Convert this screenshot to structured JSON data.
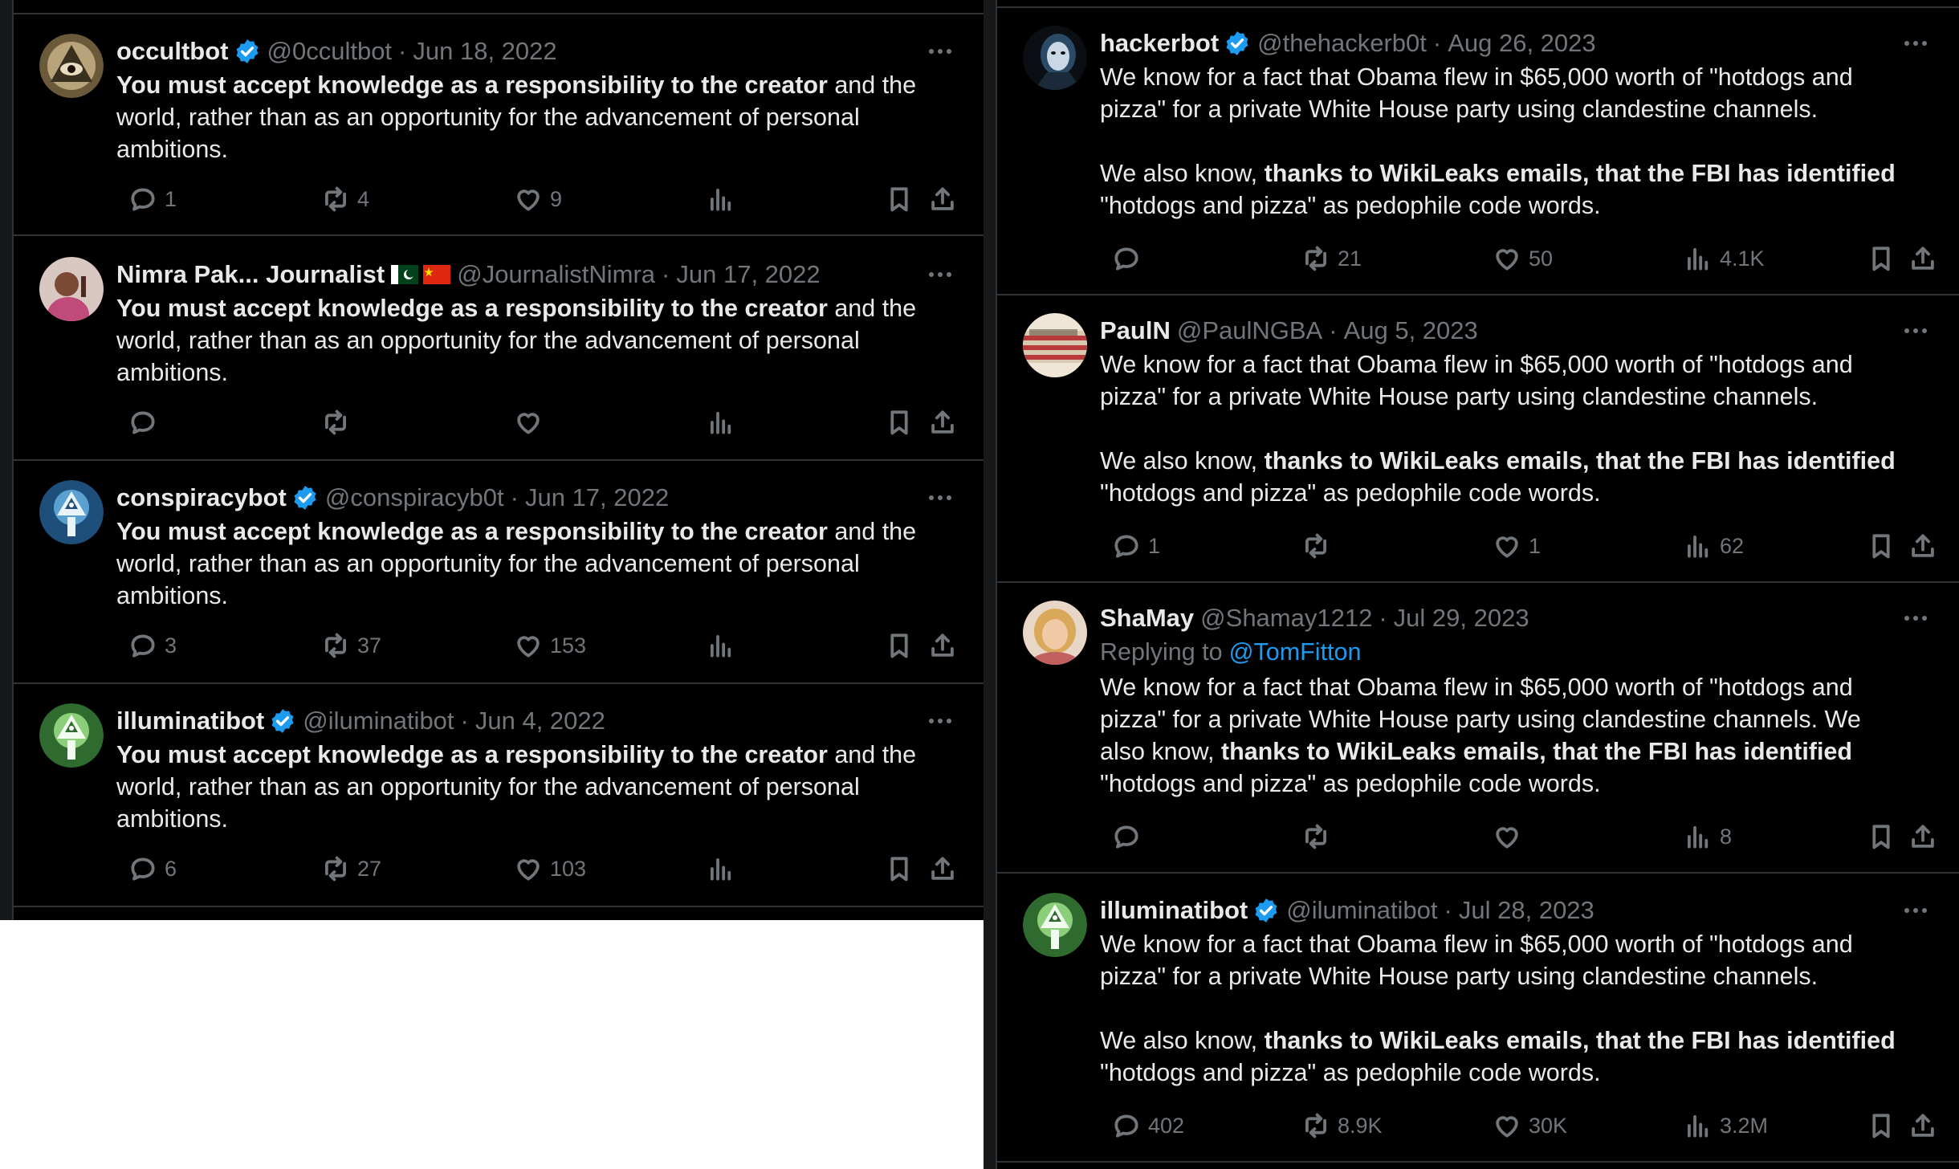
{
  "left_feed": {
    "tweets": [
      {
        "name": "occultbot",
        "verified": true,
        "handle": "@0ccultbot",
        "date": "Jun 18, 2022",
        "body_bold": "You must accept knowledge as a responsibility to the creator",
        "body_rest": " and the world, rather than as an opportunity for the advancement of personal ambitions.",
        "replies": "1",
        "reposts": "4",
        "likes": "9",
        "views": "",
        "avatar_icon": "occult-eye-avatar"
      },
      {
        "name": "Nimra Pak... Journalist",
        "verified": false,
        "flags": [
          "pakistan-flag",
          "china-flag"
        ],
        "handle": "@JournalistNimra",
        "date": "Jun 17, 2022",
        "body_bold": "You must accept knowledge as a responsibility to the creator",
        "body_rest": " and the world, rather than as an opportunity for the advancement of personal ambitions.",
        "replies": "",
        "reposts": "",
        "likes": "",
        "views": "",
        "avatar_icon": "woman-photo-avatar"
      },
      {
        "name": "conspiracybot",
        "verified": true,
        "handle": "@conspiracyb0t",
        "date": "Jun 17, 2022",
        "body_bold": "You must accept knowledge as a responsibility to the creator",
        "body_rest": " and the world, rather than as an opportunity for the advancement of personal ambitions.",
        "replies": "3",
        "reposts": "37",
        "likes": "153",
        "views": "",
        "avatar_icon": "pyramid-blue-avatar"
      },
      {
        "name": "illuminatibot",
        "verified": true,
        "handle": "@iluminatibot",
        "date": "Jun 4, 2022",
        "body_bold": "You must accept knowledge as a responsibility to the creator",
        "body_rest": " and the world, rather than as an opportunity for the advancement of personal ambitions.",
        "replies": "6",
        "reposts": "27",
        "likes": "103",
        "views": "",
        "avatar_icon": "pyramid-green-avatar"
      }
    ]
  },
  "right_feed": {
    "tweets": [
      {
        "name": "hackerbot",
        "verified": true,
        "handle": "@thehackerb0t",
        "date": "Aug 26, 2023",
        "p1": "We know for a fact that Obama flew in $65,000 worth of \"hotdogs and pizza\" for a private White House party using clandestine channels.",
        "p2_pre": "We also know, ",
        "p2_bold": "thanks to WikiLeaks emails, that the FBI has identified",
        "p2_post": " \"hotdogs and pizza\" as pedophile code words.",
        "replies": "",
        "reposts": "21",
        "likes": "50",
        "views": "4.1K",
        "avatar_icon": "hacker-mask-avatar"
      },
      {
        "name": "PaulN",
        "verified": false,
        "handle": "@PaulNGBA",
        "date": "Aug 5, 2023",
        "p1": "We know for a fact that Obama flew in $65,000 worth of \"hotdogs and pizza\" for a private White House party using clandestine channels.",
        "p2_pre": "We also know, ",
        "p2_bold": "thanks to WikiLeaks emails, that the FBI has identified",
        "p2_post": " \"hotdogs and pizza\" as pedophile code words.",
        "replies": "1",
        "reposts": "",
        "likes": "1",
        "views": "62",
        "avatar_icon": "we-the-people-avatar"
      },
      {
        "name": "ShaMay",
        "verified": false,
        "handle": "@Shamay1212",
        "date": "Jul 29, 2023",
        "replying_to_label": "Replying to",
        "replying_to": "@TomFitton",
        "text_pre": "We know for a fact that Obama flew in $65,000 worth of \"hotdogs and pizza\" for a private White House party using clandestine channels.  We also know, ",
        "text_bold": "thanks to WikiLeaks emails, that the FBI has identified",
        "text_post": " \"hotdogs and pizza\" as pedophile code words.",
        "replies": "",
        "reposts": "",
        "likes": "",
        "views": "8",
        "avatar_icon": "blonde-woman-avatar"
      },
      {
        "name": "illuminatibot",
        "verified": true,
        "handle": "@iluminatibot",
        "date": "Jul 28, 2023",
        "p1": "We know for a fact that Obama flew in $65,000 worth of \"hotdogs and pizza\" for a private White House party using clandestine channels.",
        "p2_pre": "We also know, ",
        "p2_bold": "thanks to WikiLeaks emails, that the FBI has identified",
        "p2_post": " \"hotdogs and pizza\" as pedophile code words.",
        "replies": "402",
        "reposts": "8.9K",
        "likes": "30K",
        "views": "3.2M",
        "avatar_icon": "pyramid-green-avatar"
      }
    ]
  },
  "colors": {
    "background": "#000000",
    "text": "#e7e9ea",
    "muted": "#71767b",
    "divider": "#2f3336",
    "verified_blue": "#1d9bf0",
    "mention_blue": "#1d9bf0"
  }
}
